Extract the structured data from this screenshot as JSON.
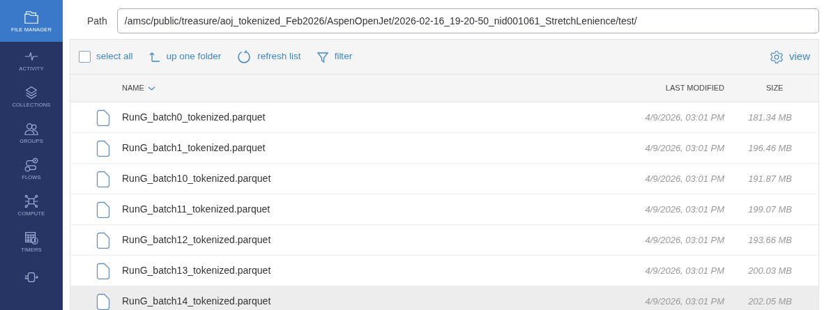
{
  "sidebar": {
    "items": [
      {
        "kind": "folder",
        "label": "FILE MANAGER",
        "selected": true
      },
      {
        "kind": "pulse",
        "label": "ACTIVITY",
        "selected": false
      },
      {
        "kind": "layers",
        "label": "COLLECTIONS",
        "selected": false
      },
      {
        "kind": "people",
        "label": "GROUPS",
        "selected": false
      },
      {
        "kind": "flow",
        "label": "FLOWS",
        "selected": false
      },
      {
        "kind": "chip",
        "label": "COMPUTE",
        "selected": false
      },
      {
        "kind": "calendar",
        "label": "TIMERS",
        "selected": false
      },
      {
        "kind": "plug",
        "selected": false
      }
    ]
  },
  "path": {
    "label": "Path",
    "value": "/amsc/public/treasure/aoj_tokenized_Feb2026/AspenOpenJet/2026-02-16_19-20-50_nid001061_StretchLenience/test/"
  },
  "toolbar": {
    "select_all": {
      "label": "select all",
      "checked": false
    },
    "up": "up one folder",
    "refresh": "refresh list",
    "filter": "filter",
    "view": "view"
  },
  "table": {
    "columns": [
      "NAME",
      "LAST MODIFIED",
      "SIZE"
    ],
    "rows": [
      {
        "name": "RunG_batch0_tokenized.parquet",
        "modified": "4/9/2026, 03:01 PM",
        "size": "181.34 MB",
        "hovered": false
      },
      {
        "name": "RunG_batch1_tokenized.parquet",
        "modified": "4/9/2026, 03:01 PM",
        "size": "196.46 MB",
        "hovered": false
      },
      {
        "name": "RunG_batch10_tokenized.parquet",
        "modified": "4/9/2026, 03:01 PM",
        "size": "191.87 MB",
        "hovered": false
      },
      {
        "name": "RunG_batch11_tokenized.parquet",
        "modified": "4/9/2026, 03:01 PM",
        "size": "199.07 MB",
        "hovered": false
      },
      {
        "name": "RunG_batch12_tokenized.parquet",
        "modified": "4/9/2026, 03:01 PM",
        "size": "193.66 MB",
        "hovered": false
      },
      {
        "name": "RunG_batch13_tokenized.parquet",
        "modified": "4/9/2026, 03:01 PM",
        "size": "200.03 MB",
        "hovered": false
      },
      {
        "name": "RunG_batch14_tokenized.parquet",
        "modified": "4/9/2026, 03:01 PM",
        "size": "202.05 MB",
        "hovered": true
      }
    ]
  }
}
